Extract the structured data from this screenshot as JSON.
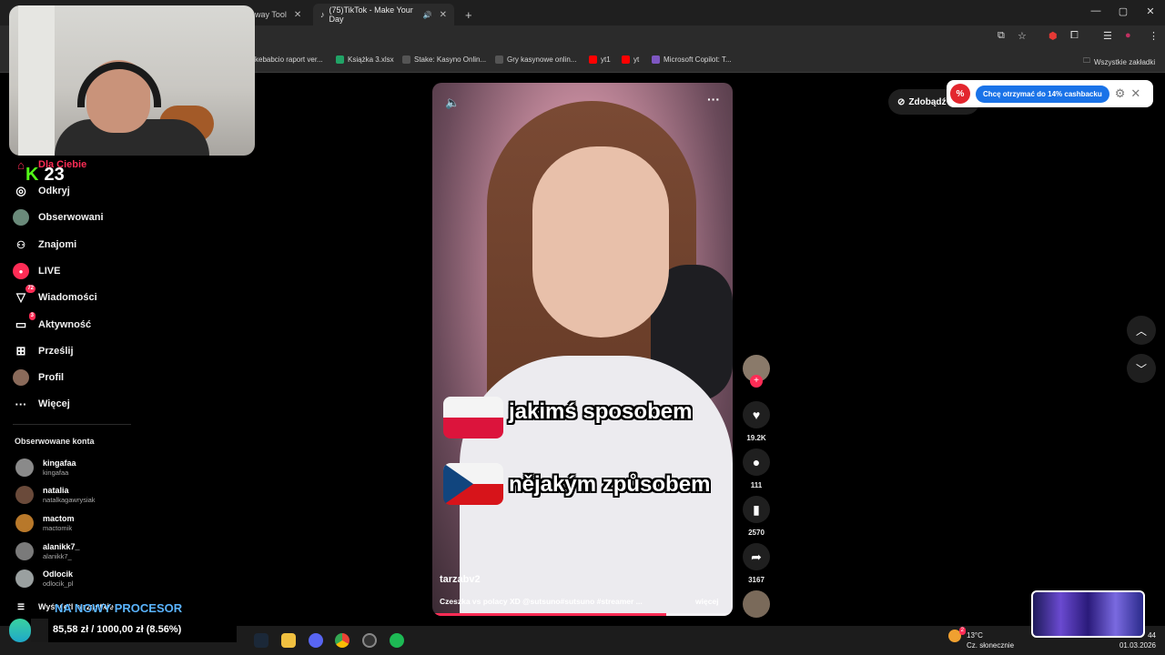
{
  "browser": {
    "tabs": [
      {
        "title": "eaway Tool",
        "active": false
      },
      {
        "title": "(75)TikTok - Make Your Day",
        "active": true
      }
    ],
    "new_tab": "+",
    "bookmarks": [
      {
        "label": "kebabcio raport ver...",
        "color": "#4caf50"
      },
      {
        "label": "Książka 3.xlsx",
        "color": "#21a366"
      },
      {
        "label": "Stake: Kasyno Onlin...",
        "color": "#555555"
      },
      {
        "label": "Gry kasynowe onlin...",
        "color": "#555555"
      },
      {
        "label": "yt1",
        "color": "#ff0000"
      },
      {
        "label": "yt",
        "color": "#ff0000"
      },
      {
        "label": "Microsoft Copilot: T...",
        "color": "#7e57c2"
      }
    ],
    "all_bookmarks": "Wszystkie zakładki"
  },
  "stream_overlay": {
    "counter": "23",
    "goal_title": "NA NOWY PROCESOR",
    "goal_progress": "85,58 zł / 1000,00 zł (8.56%)",
    "goal_fraction": 0.0856
  },
  "sidebar": {
    "items": [
      {
        "label": "Dla Ciebie",
        "icon": "home-icon",
        "glyph": "⌂",
        "active": true
      },
      {
        "label": "Odkryj",
        "icon": "compass-icon",
        "glyph": "◎"
      },
      {
        "label": "Obserwowani",
        "icon": "following-icon",
        "glyph": "●"
      },
      {
        "label": "Znajomi",
        "icon": "friends-icon",
        "glyph": "👥"
      },
      {
        "label": "LIVE",
        "icon": "live-icon",
        "glyph": "●"
      },
      {
        "label": "Wiadomości",
        "icon": "messages-icon",
        "glyph": "▽",
        "badge": "72"
      },
      {
        "label": "Aktywność",
        "icon": "activity-icon",
        "glyph": "▭",
        "badge": "3"
      },
      {
        "label": "Prześlij",
        "icon": "upload-icon",
        "glyph": "⊞"
      },
      {
        "label": "Profil",
        "icon": "profile-icon",
        "glyph": "●"
      },
      {
        "label": "Więcej",
        "icon": "more-icon",
        "glyph": "···"
      }
    ],
    "following_title": "Obserwowane konta",
    "accounts": [
      {
        "name": "kingafaa",
        "handle": "kingafaa",
        "color": "#8a8a8a"
      },
      {
        "name": "natalia",
        "handle": "natalkagawrysiak",
        "color": "#6a4a3a"
      },
      {
        "name": "mactom",
        "handle": "mactomik",
        "color": "#b8782a"
      },
      {
        "name": "alanikk7_",
        "handle": "alanikk7_",
        "color": "#7a7a7a"
      },
      {
        "name": "Odlocik",
        "handle": "odlocik_pl",
        "color": "#9aa0a0"
      }
    ],
    "see_all": "Wyświetl wszystkie"
  },
  "video": {
    "author": "tarzabv2",
    "description": "Czeszka vs polacy XD @sutsuno#sutsuno #streamer ...",
    "more": "więcej",
    "caption_pl": "jakimś sposobem",
    "caption_cz": "nějakým způsobem",
    "progress": 0.78
  },
  "actions": {
    "likes": "19.2K",
    "comments": "111",
    "saves": "2570",
    "shares": "3167"
  },
  "right_panel": {
    "get_coins": "Zdobądź",
    "cashback_button": "Chcę otrzymać do 14% cashbacku"
  },
  "taskbar": {
    "weather_temp": "13°C",
    "weather_desc": "Cz. słonecznie",
    "time": "44",
    "date": "01.03.2026",
    "notification_badge": "2"
  }
}
